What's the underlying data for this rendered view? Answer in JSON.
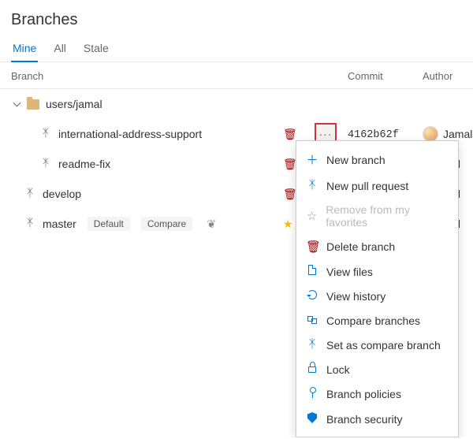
{
  "title": "Branches",
  "tabs": [
    {
      "label": "Mine",
      "active": true
    },
    {
      "label": "All",
      "active": false
    },
    {
      "label": "Stale",
      "active": false
    }
  ],
  "columns": {
    "branch": "Branch",
    "commit": "Commit",
    "author": "Author"
  },
  "folder": {
    "name": "users/jamal"
  },
  "rows": [
    {
      "name": "international-address-support",
      "commit": "4162b62f",
      "author": "Jamal"
    },
    {
      "name": "readme-fix",
      "author_suffix": "mal"
    },
    {
      "name": "develop",
      "author_suffix": "mal"
    },
    {
      "name": "master",
      "default_badge": "Default",
      "compare_badge": "Compare",
      "author_suffix": "mal"
    }
  ],
  "menu": {
    "new_branch": "New branch",
    "new_pr": "New pull request",
    "remove_fav": "Remove from my favorites",
    "delete": "Delete branch",
    "view_files": "View files",
    "view_history": "View history",
    "compare": "Compare branches",
    "set_compare": "Set as compare branch",
    "lock": "Lock",
    "policies": "Branch policies",
    "security": "Branch security"
  }
}
